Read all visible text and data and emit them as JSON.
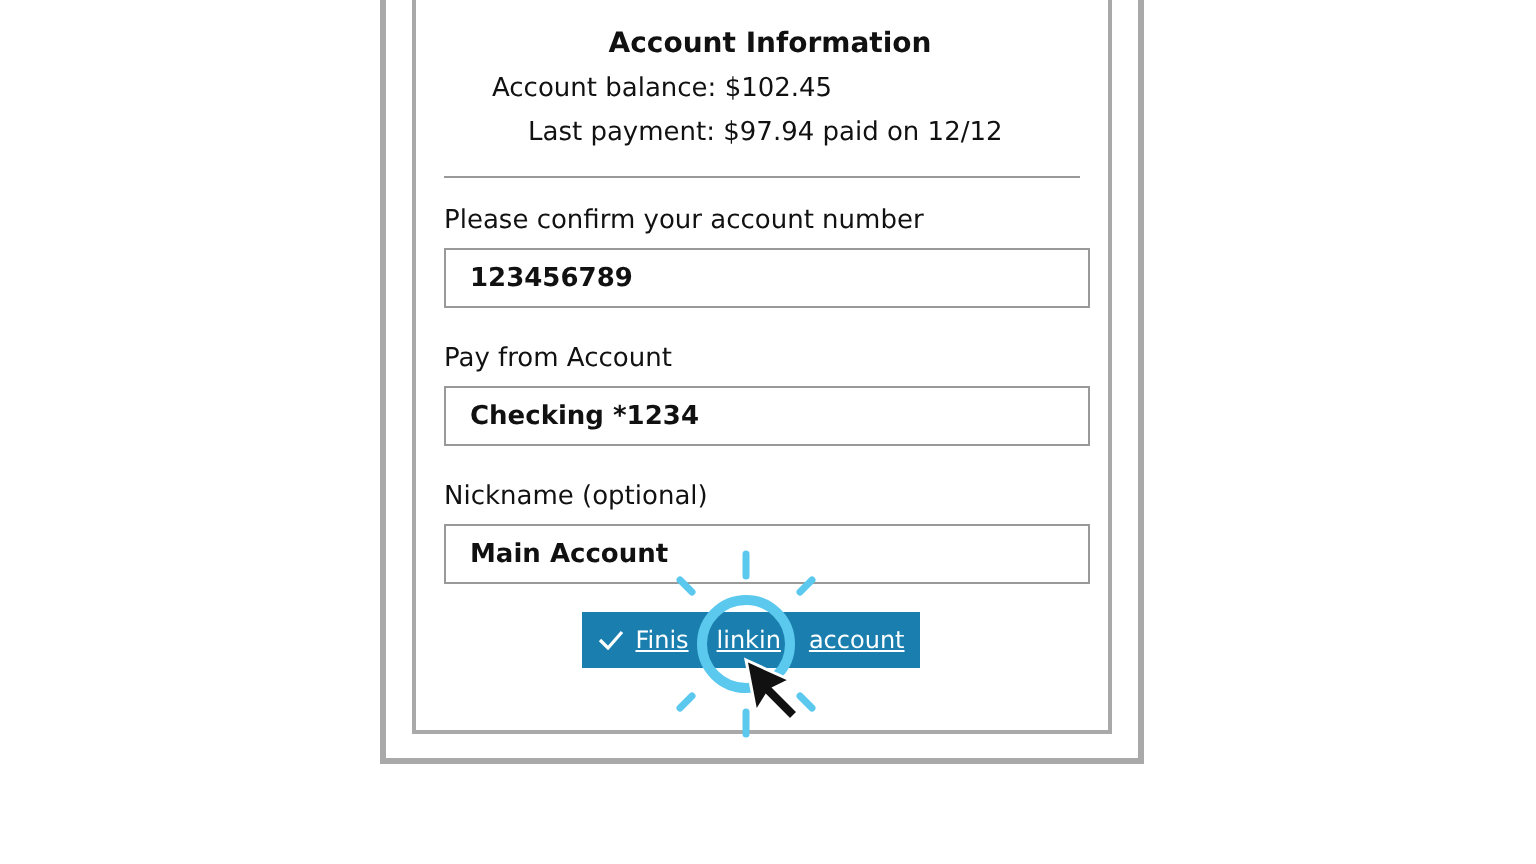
{
  "section": {
    "title": "Account Information"
  },
  "info_lines": [
    "Account balance: $102.45",
    "Last payment: $97.94 paid on 12/12"
  ],
  "fields": [
    {
      "label": "Please confirm your account number",
      "value": "123456789"
    },
    {
      "label": "Pay from Account",
      "value": "Checking *1234"
    },
    {
      "label": "Nickname (optional)",
      "value": "Main Account"
    }
  ],
  "submit_button": {
    "label_parts": [
      "Finis",
      "linkin",
      "account"
    ]
  }
}
